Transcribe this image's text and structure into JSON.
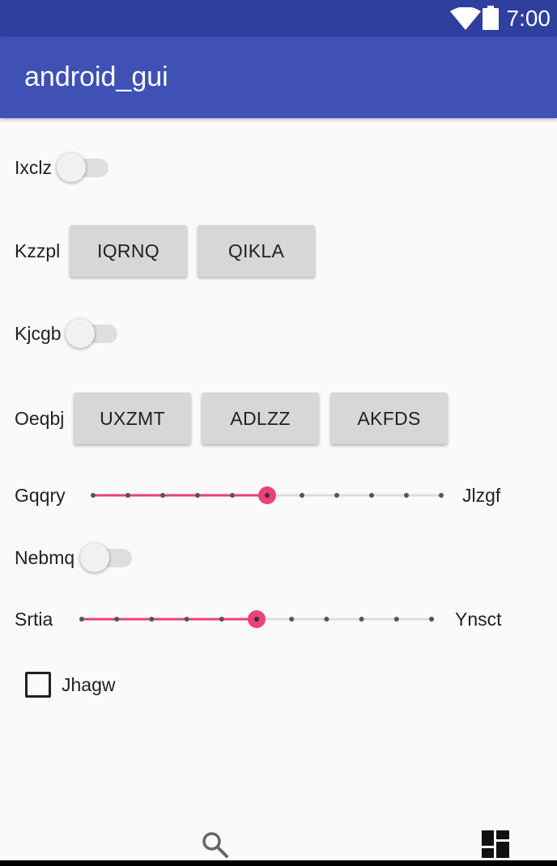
{
  "status_bar": {
    "time": "7:00",
    "icons": [
      "wifi-icon",
      "battery-icon"
    ]
  },
  "app_bar": {
    "title": "android_gui"
  },
  "colors": {
    "status_bar": "#2f3f9d",
    "app_bar": "#3f51b5",
    "accent": "#ec407a",
    "background": "#fafafa",
    "button": "#d6d7d7"
  },
  "form": {
    "switch_1": {
      "label": "Ixclz",
      "checked": false
    },
    "button_row_1": {
      "label": "Kzzpl",
      "buttons": [
        "IQRNQ",
        "QIKLA"
      ]
    },
    "switch_2": {
      "label": "Kjcgb",
      "checked": false
    },
    "button_row_2": {
      "label": "Oeqbj",
      "buttons": [
        "UXZMT",
        "ADLZZ",
        "AKFDS"
      ]
    },
    "slider_1": {
      "label_left": "Gqqry",
      "label_right": "Jlzgf",
      "steps": 10,
      "value": 5
    },
    "switch_3": {
      "label": "Nebmq",
      "checked": false
    },
    "slider_2": {
      "label_left": "Srtia",
      "label_right": "Ynsct",
      "steps": 10,
      "value": 5
    },
    "checkbox": {
      "label": "Jhagw",
      "checked": false
    }
  },
  "bottom_bar": {
    "icons": [
      "search-icon",
      "dashboard-icon"
    ]
  }
}
